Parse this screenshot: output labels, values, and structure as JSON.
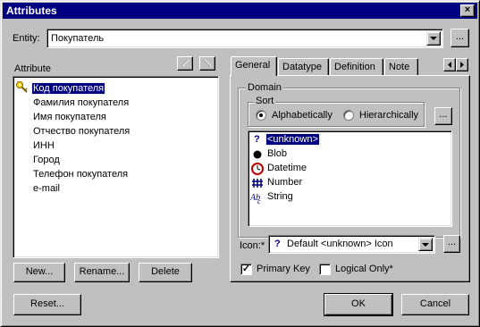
{
  "window": {
    "title": "Attributes",
    "close_glyph": "×"
  },
  "entity": {
    "label": "Entity:",
    "value": "Покупатель",
    "browse_label": "..."
  },
  "attributes": {
    "label": "Attribute",
    "items": [
      "Код покупателя",
      "Фамилия покупателя",
      "Имя покупателя",
      "Отчество покупателя",
      "ИНН",
      "Город",
      "Телефон покупателя",
      "e-mail"
    ],
    "selected_index": 0
  },
  "buttons": {
    "new": "New...",
    "rename": "Rename...",
    "delete": "Delete",
    "reset": "Reset...",
    "ok": "OK",
    "cancel": "Cancel"
  },
  "tabs": [
    "General",
    "Datatype",
    "Definition",
    "Note"
  ],
  "active_tab": "General",
  "domain": {
    "group_label": "Domain",
    "sort_label": "Sort",
    "sort_options": [
      "Alphabetically",
      "Hierarchically"
    ],
    "sort_selected": "Alphabetically",
    "browse_label": "...",
    "items": [
      "<unknown>",
      "Blob",
      "Datetime",
      "Number",
      "String"
    ],
    "selected_index": 0
  },
  "icon": {
    "label": "Icon:*",
    "value": "Default <unknown> Icon",
    "browse_label": "..."
  },
  "primary_key": {
    "label": "Primary Key",
    "checked": true
  },
  "logical_only": {
    "label": "Logical Only*",
    "checked": false
  },
  "colors": {
    "title_bar": "#000080",
    "face": "#c0c0c0",
    "selection": "#000080"
  }
}
